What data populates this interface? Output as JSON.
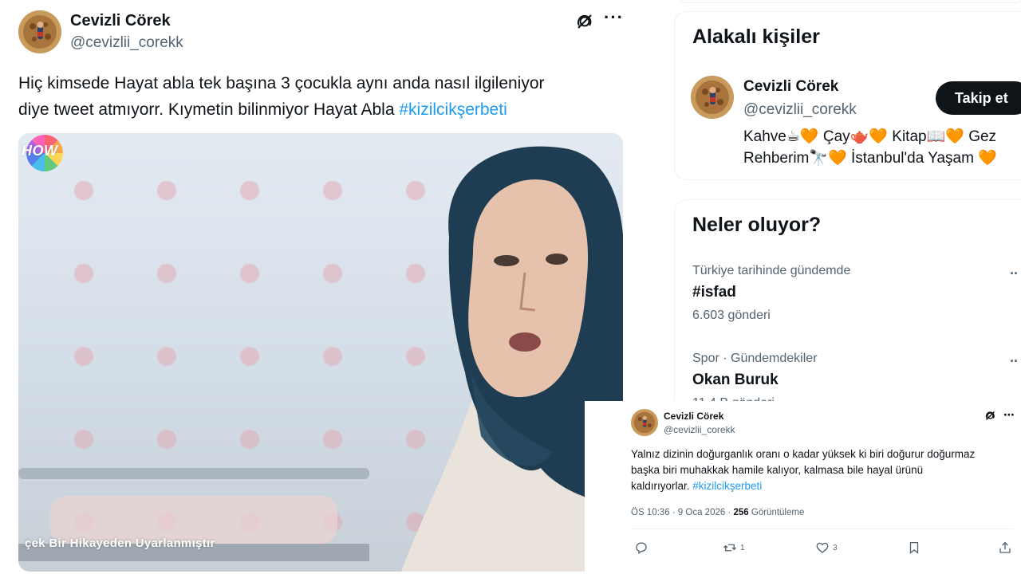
{
  "main_tweet": {
    "author_name": "Cevizli Cörek",
    "author_handle": "@cevizlii_corekk",
    "text_line1": "Hiç kimsede Hayat abla tek başına 3 çocukla aynı anda nasıl ilgileniyor",
    "text_line2": "diye tweet atmıyorr. Kıymetin bilinmiyor Hayat Abla ",
    "hashtag": "#kizilcikşerbeti",
    "video_logo": "HOW",
    "video_caption": "çek Bir Hikayeden Uyarlanmıştır",
    "icons": [
      "grok-icon",
      "more-icon"
    ]
  },
  "related": {
    "title": "Alakalı kişiler",
    "name": "Cevizli Cörek",
    "handle": "@cevizlii_corekk",
    "follow_label": "Takip et",
    "bio_line1_parts": [
      "Kahve☕",
      "🧡",
      " Çay🫖",
      "🧡",
      " Kitap📖",
      "🧡",
      " Gez"
    ],
    "bio_line2_parts": [
      "Rehberim🔭",
      "🧡",
      " İstanbul'da Yaşam ",
      "🧡"
    ]
  },
  "trends": {
    "title": "Neler oluyor?",
    "items": [
      {
        "meta": "Türkiye tarihinde gündemde",
        "name": "#isfad",
        "count": "6.603 gönderi"
      },
      {
        "meta": "Spor · Gündemdekiler",
        "name": "Okan Buruk",
        "count": "11,4 B gönderi"
      }
    ]
  },
  "overlay_tweet": {
    "author_name": "Cevizli Cörek",
    "author_handle": "@cevizlii_corekk",
    "text_line1": "Yalnız dizinin doğurganlık oranı o kadar yüksek ki biri doğurur doğurmaz",
    "text_line2": "başka biri muhakkak hamile kalıyor, kalmasa bile hayal ürünü",
    "text_line3": "kaldırıyorlar. ",
    "hashtag": "#kizilcikşerbeti",
    "time": "ÖS 10:36 · 9 Oca 2026 · ",
    "views_count": "256",
    "views_label": " Görüntüleme",
    "reply_count": "",
    "retweet_count": "1",
    "like_count": "3",
    "colors": {
      "link": "#1d9bf0",
      "secondary": "#536471",
      "text": "#0f1419",
      "heart": "#d97a52"
    }
  }
}
